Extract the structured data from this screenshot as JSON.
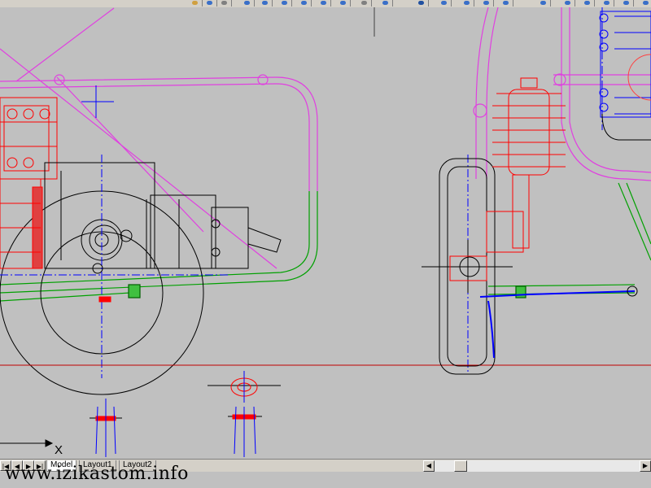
{
  "toolbar": {
    "icons": [
      "layer-icon",
      "cube-icon",
      "save-icon",
      "circle-icon",
      "sphere-icon",
      "cylinder-icon",
      "cone-icon",
      "wedge-icon",
      "torus-icon",
      "pin-icon",
      "box-icon",
      "edit-icon",
      "rotate-icon",
      "shade-icon",
      "render-icon",
      "cube-render-icon"
    ]
  },
  "drawing": {
    "ucs_x_label": "X"
  },
  "tabs": [
    {
      "label": "Model",
      "active": true
    },
    {
      "label": "Layout1",
      "active": false
    },
    {
      "label": "Layout2",
      "active": false
    }
  ],
  "nav": {
    "first": "|◀",
    "prev": "◀",
    "next": "▶",
    "last": "▶|"
  },
  "scroll": {
    "left": "◀",
    "right": "▶"
  },
  "watermark": "www.izikastom.info",
  "colors": {
    "background": "#c0c0c0",
    "magenta": "#e040e0",
    "red": "#ff0000",
    "blue": "#0000ff",
    "green": "#00a000",
    "black": "#000000",
    "darkred": "#c00000"
  }
}
